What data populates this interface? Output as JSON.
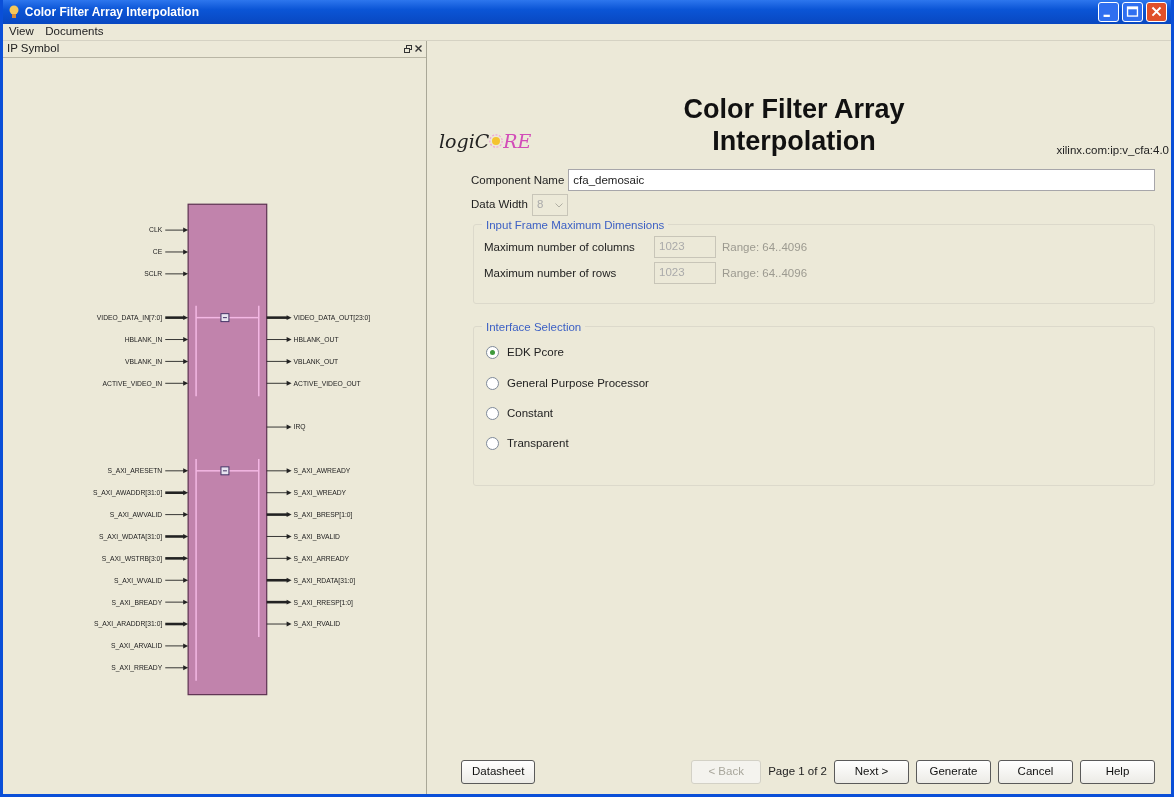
{
  "window": {
    "title": "Color Filter Array Interpolation"
  },
  "menu": [
    {
      "label": "View"
    },
    {
      "label": "Documents"
    }
  ],
  "panel": {
    "title": "IP Symbol"
  },
  "symbol": {
    "sections": [
      {
        "kind": "plain",
        "left": [
          {
            "label": "CLK",
            "bus": false
          },
          {
            "label": "CE",
            "bus": false
          },
          {
            "label": "SCLR",
            "bus": false
          }
        ]
      },
      {
        "kind": "group",
        "expanded": true,
        "left": [
          {
            "label": "VIDEO_DATA_IN[7:0]",
            "bus": true
          },
          {
            "label": "HBLANK_IN",
            "bus": false
          },
          {
            "label": "VBLANK_IN",
            "bus": false
          },
          {
            "label": "ACTIVE_VIDEO_IN",
            "bus": false
          }
        ],
        "right": [
          {
            "label": "VIDEO_DATA_OUT[23:0]",
            "bus": true
          },
          {
            "label": "HBLANK_OUT",
            "bus": false
          },
          {
            "label": "VBLANK_OUT",
            "bus": false
          },
          {
            "label": "ACTIVE_VIDEO_OUT",
            "bus": false
          }
        ]
      },
      {
        "kind": "plain",
        "right": [
          {
            "label": "IRQ",
            "bus": false
          }
        ]
      },
      {
        "kind": "group",
        "expanded": true,
        "left": [
          {
            "label": "S_AXI_ARESETN",
            "bus": false
          },
          {
            "label": "S_AXI_AWADDR[31:0]",
            "bus": true
          },
          {
            "label": "S_AXI_AWVALID",
            "bus": false
          },
          {
            "label": "S_AXI_WDATA[31:0]",
            "bus": true
          },
          {
            "label": "S_AXI_WSTRB[3:0]",
            "bus": true
          },
          {
            "label": "S_AXI_WVALID",
            "bus": false
          },
          {
            "label": "S_AXI_BREADY",
            "bus": false
          },
          {
            "label": "S_AXI_ARADDR[31:0]",
            "bus": true
          },
          {
            "label": "S_AXI_ARVALID",
            "bus": false
          },
          {
            "label": "S_AXI_RREADY",
            "bus": false
          }
        ],
        "right": [
          {
            "label": "S_AXI_AWREADY",
            "bus": false
          },
          {
            "label": "S_AXI_WREADY",
            "bus": false
          },
          {
            "label": "S_AXI_BRESP[1:0]",
            "bus": true
          },
          {
            "label": "S_AXI_BVALID",
            "bus": false
          },
          {
            "label": "S_AXI_ARREADY",
            "bus": false
          },
          {
            "label": "S_AXI_RDATA[31:0]",
            "bus": true
          },
          {
            "label": "S_AXI_RRESP[1:0]",
            "bus": true
          },
          {
            "label": "S_AXI_RVALID",
            "bus": false
          }
        ]
      }
    ]
  },
  "header": {
    "logo": [
      "logiC",
      "RE"
    ],
    "title": [
      "Color Filter Array",
      "Interpolation"
    ],
    "vlnv": "xilinx.com:ip:v_cfa:4.0"
  },
  "component_name": {
    "label": "Component Name",
    "value": "cfa_demosaic"
  },
  "data_width": {
    "label": "Data Width",
    "value": "8",
    "disabled": true
  },
  "dimensions": {
    "title": "Input Frame Maximum Dimensions",
    "fields": [
      {
        "label": "Maximum number of columns",
        "value": "1023",
        "range": "Range: 64..4096",
        "disabled": true
      },
      {
        "label": "Maximum number of rows",
        "value": "1023",
        "range": "Range: 64..4096",
        "disabled": true
      }
    ]
  },
  "interface": {
    "title": "Interface Selection",
    "options": [
      {
        "label": "EDK Pcore",
        "selected": true
      },
      {
        "label": "General Purpose Processor",
        "selected": false
      },
      {
        "label": "Constant",
        "selected": false
      },
      {
        "label": "Transparent",
        "selected": false
      }
    ]
  },
  "footer": {
    "datasheet": {
      "label": "Datasheet"
    },
    "back": {
      "label": "< Back",
      "disabled": true
    },
    "page": "Page 1 of 2",
    "buttons": [
      {
        "label": "Next >"
      },
      {
        "label": "Generate"
      },
      {
        "label": "Cancel"
      },
      {
        "label": "Help"
      }
    ]
  }
}
